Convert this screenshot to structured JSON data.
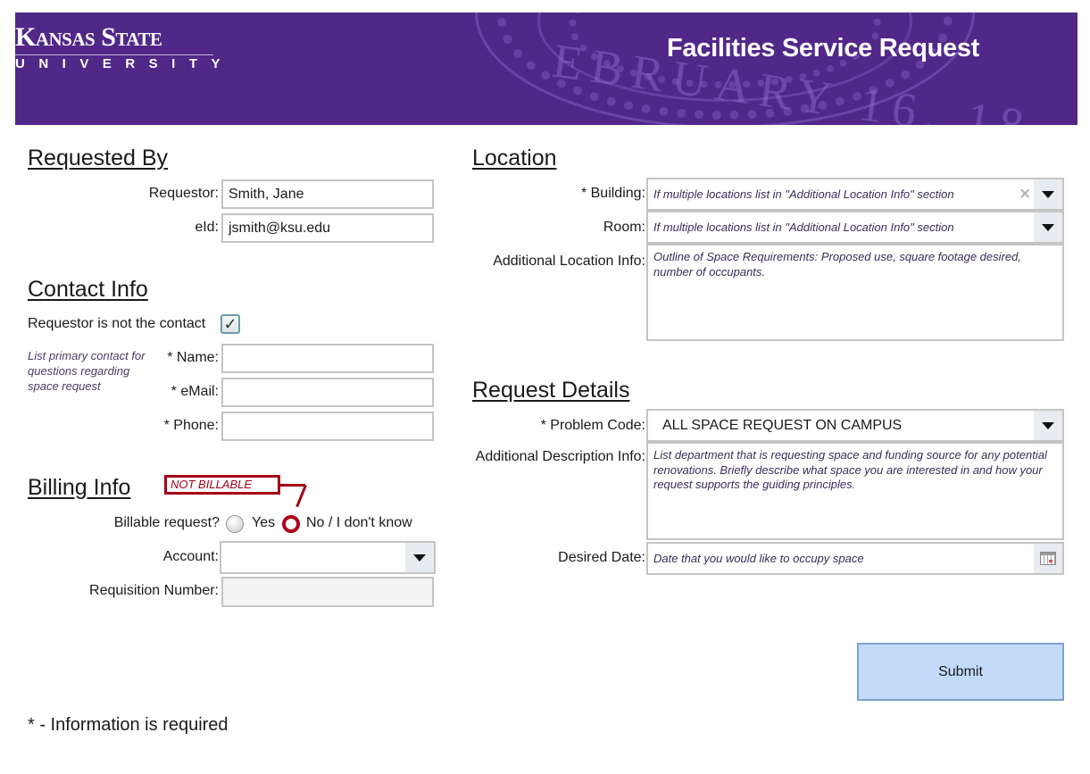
{
  "header": {
    "logo_top": "Kansas State",
    "logo_bottom": "UNIVERSITY",
    "seal_text": "EBRUARY 16, 18",
    "title": "Facilities Service Request",
    "brand_color": "#512888"
  },
  "requested_by": {
    "title": "Requested By",
    "requestor_label": "Requestor:",
    "requestor_value": "Smith, Jane",
    "eid_label": "eId:",
    "eid_value": "jsmith@ksu.edu"
  },
  "contact_info": {
    "title": "Contact Info",
    "checkbox_label": "Requestor is not the contact",
    "checkbox_checked": true,
    "checkmark": "✓",
    "hint": "List primary contact for questions regarding space request",
    "name_label": "* Name:",
    "name_value": "",
    "email_label": "* eMail:",
    "email_value": "",
    "phone_label": "* Phone:",
    "phone_value": ""
  },
  "billing_info": {
    "title": "Billing Info",
    "annotation": "NOT BILLABLE",
    "billable_label": "Billable request?",
    "options": [
      "Yes",
      "No / I don't know"
    ],
    "selected_option": "No / I don't know",
    "account_label": "Account:",
    "account_value": "",
    "requisition_label": "Requisition Number:",
    "requisition_value": ""
  },
  "location": {
    "title": "Location",
    "building_label": "* Building:",
    "building_placeholder": "If multiple locations list in \"Additional Location Info\" section",
    "room_label": "Room:",
    "room_placeholder": "If multiple locations list in \"Additional Location Info\" section",
    "additional_label": "Additional Location Info:",
    "additional_placeholder": "Outline of Space Requirements: Proposed use, square footage desired, number of occupants.",
    "clear_icon": "×"
  },
  "request_details": {
    "title": "Request Details",
    "problem_code_label": "* Problem Code:",
    "problem_code_value": "ALL SPACE REQUEST ON CAMPUS",
    "description_label": "Additional Description Info:",
    "description_placeholder": "List department that is requesting space and funding source for any potential renovations.  Briefly describe what space you are interested in and how your request supports the guiding principles.",
    "date_label": "Desired Date:",
    "date_placeholder": "Date that you would like to occupy space"
  },
  "actions": {
    "submit_label": "Submit"
  },
  "footnote": "* - Information is required"
}
